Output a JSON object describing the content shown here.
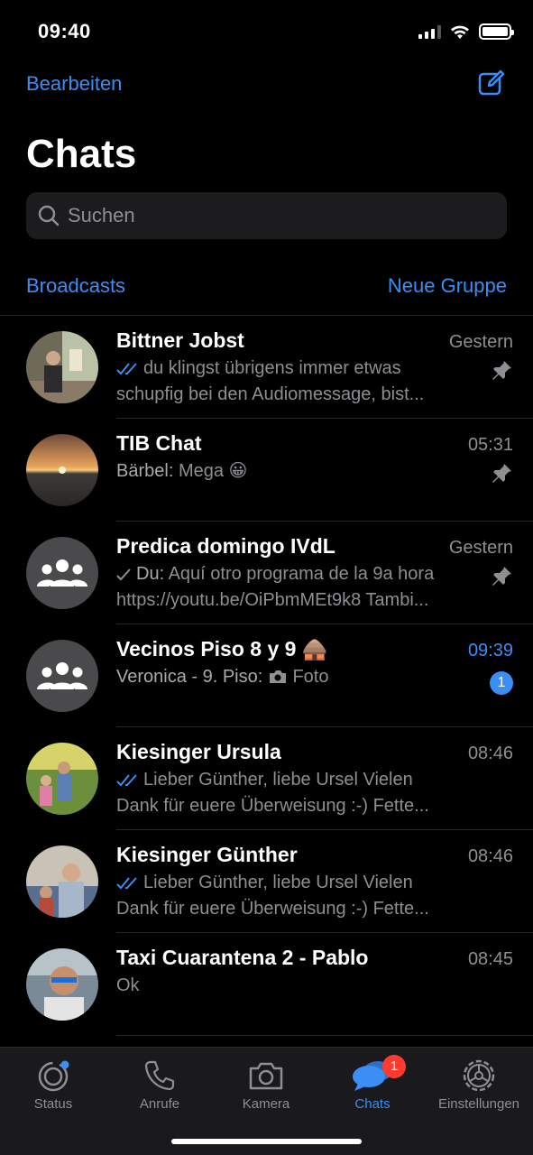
{
  "status_bar": {
    "time": "09:40"
  },
  "header": {
    "edit_label": "Bearbeiten",
    "title": "Chats",
    "search_placeholder": "Suchen",
    "broadcasts_label": "Broadcasts",
    "new_group_label": "Neue Gruppe"
  },
  "colors": {
    "accent": "#3a8ef6",
    "background": "#000000",
    "badge_red": "#ff3b30",
    "secondary_text": "#8e8e93"
  },
  "chats": [
    {
      "name": "Bittner Jobst",
      "time": "Gestern",
      "line1": "du klingst übrigens immer etwas",
      "line2": "schupfig bei den Audiomessage, bist...",
      "status": "read",
      "pinned": true
    },
    {
      "name": "TIB Chat",
      "time": "05:31",
      "sender": "Bärbel:",
      "line1": "Mega 😀",
      "pinned": true
    },
    {
      "name": "Predica domingo IVdL",
      "time": "Gestern",
      "sender": "Du:",
      "line1": "Aquí otro programa de la 9a hora",
      "line2": "https://youtu.be/OiPbmMEt9k8 Tambi...",
      "status": "sent",
      "pinned": true,
      "group": true
    },
    {
      "name": "Vecinos Piso 8 y 9 🛖",
      "time": "09:39",
      "sender": "Veronica - 9. Piso:",
      "line1": "Foto",
      "unread_count": "1",
      "group": true
    },
    {
      "name": "Kiesinger Ursula",
      "time": "08:46",
      "line1": "Lieber Günther, liebe Ursel Vielen",
      "line2": "Dank für euere Überweisung :-) Fette...",
      "status": "read"
    },
    {
      "name": "Kiesinger Günther",
      "time": "08:46",
      "line1": "Lieber Günther, liebe Ursel Vielen",
      "line2": "Dank für euere Überweisung :-) Fette...",
      "status": "read"
    },
    {
      "name": "Taxi Cuarantena 2 - Pablo",
      "time": "08:45",
      "line1": "Ok"
    }
  ],
  "tabs": [
    {
      "label": "Status",
      "icon": "status-icon"
    },
    {
      "label": "Anrufe",
      "icon": "phone-icon"
    },
    {
      "label": "Kamera",
      "icon": "camera-icon"
    },
    {
      "label": "Chats",
      "icon": "chats-icon",
      "active": true,
      "badge": "1"
    },
    {
      "label": "Einstellungen",
      "icon": "settings-icon"
    }
  ]
}
